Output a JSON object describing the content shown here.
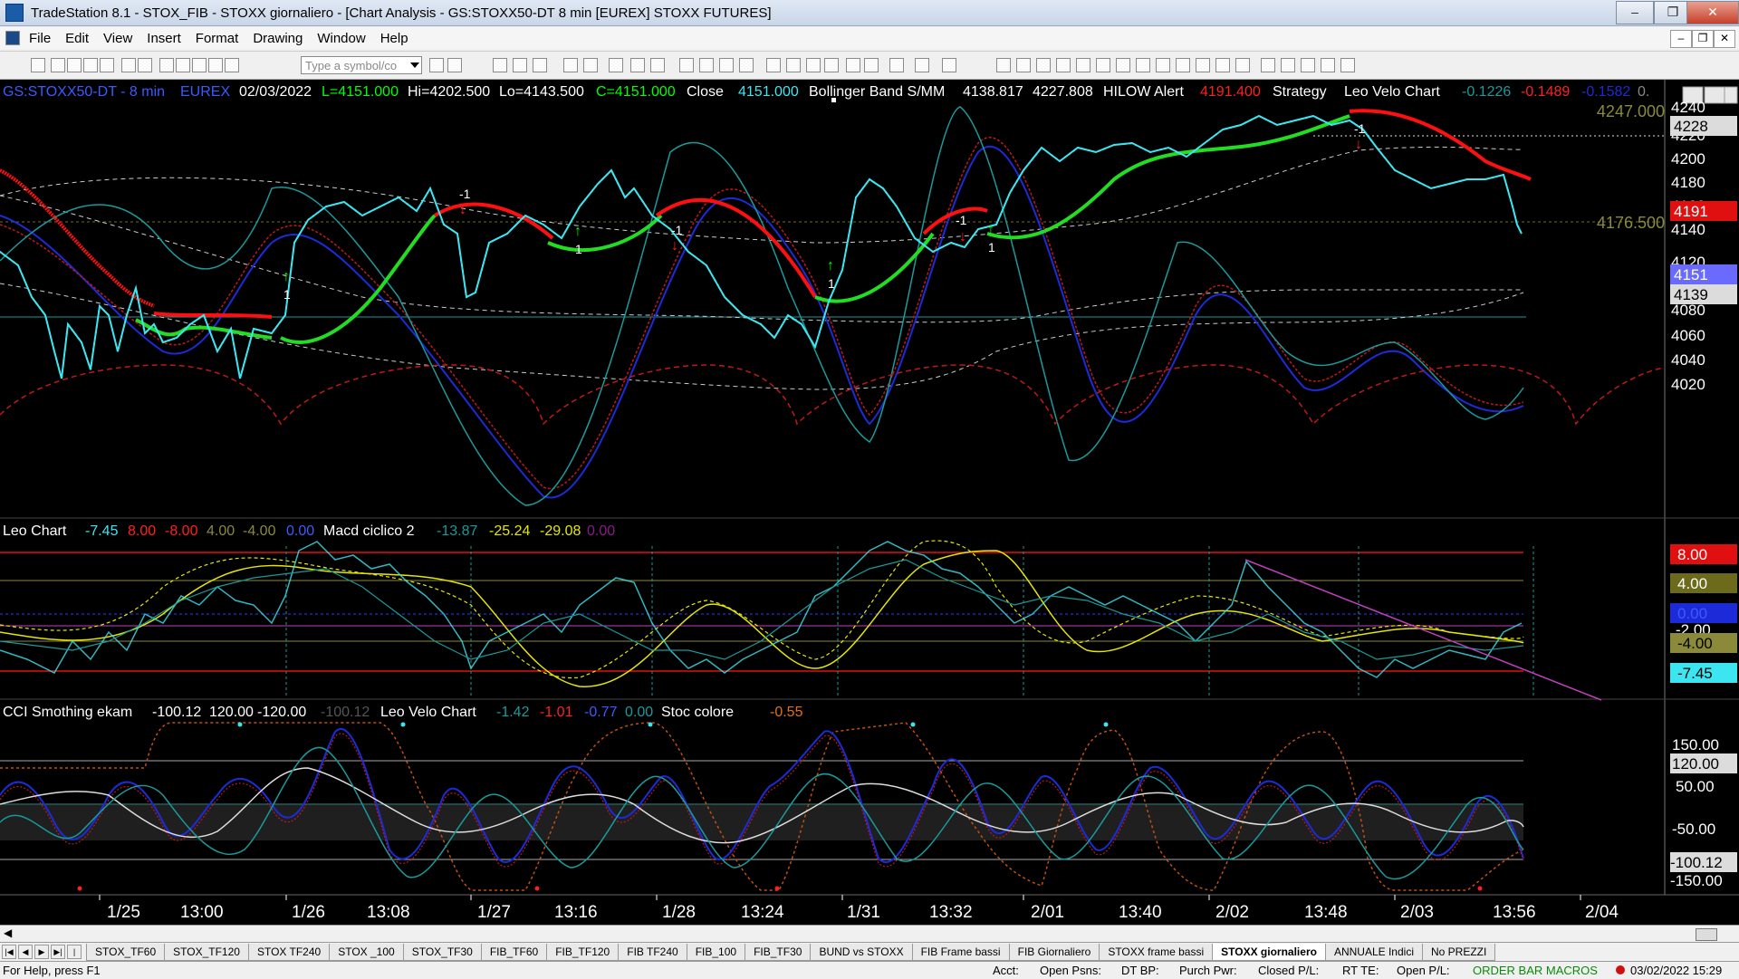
{
  "window": {
    "title": "TradeStation 8.1 - STOX_FIB - STOXX giornaliero - [Chart Analysis - GS:STOXX50-DT  8 min  [EUREX] STOXX FUTURES]"
  },
  "menu": [
    "File",
    "Edit",
    "View",
    "Insert",
    "Format",
    "Drawing",
    "Window",
    "Help"
  ],
  "toolbar": {
    "symbol_placeholder": "Type a symbol/co"
  },
  "header": {
    "symbol": "GS:STOXX50-DT - 8 min",
    "exchange": "EUREX",
    "date": "02/03/2022",
    "last": "L=4151.000",
    "high": "Hi=4202.500",
    "low": "Lo=4143.500",
    "close_eq": "C=4151.000",
    "close_label": "Close",
    "close_value": "4151.000",
    "bb_label": "Bollinger Band S/MM",
    "bb_v1": "4138.817",
    "bb_v2": "4227.808",
    "hilow_label": "HILOW Alert",
    "hilow_value": "4191.400",
    "strategy": "Strategy",
    "lvc_label": "Leo Velo Chart",
    "lvc_v1": "-0.1226",
    "lvc_v2": "-0.1489",
    "lvc_v3": "-0.1582",
    "lvc_v4": "0."
  },
  "price_axis": {
    "ticks": [
      "4240",
      "4220",
      "4200",
      "4180",
      "4160",
      "4140",
      "4120",
      "4100",
      "4080",
      "4060",
      "4040",
      "4020"
    ],
    "labels": {
      "a": "4228",
      "b": "4191",
      "c": "4151",
      "d": "4139",
      "top": "4247.000",
      "mid": "4176.500"
    }
  },
  "panel2": {
    "title": "Leo Chart",
    "v1": "-7.45",
    "v2": "8.00",
    "v3": "-8.00",
    "v4": "4.00",
    "v5": "-4.00",
    "v6": "0.00",
    "macd_label": "Macd ciclico 2",
    "m1": "-13.87",
    "m2": "-25.24",
    "m3": "-29.08",
    "m4": "0.00",
    "axis": {
      "a": "8.00",
      "b": "4.00",
      "c": "0.00",
      "d": "-2.00",
      "e": "-4.00",
      "f": "-7.45"
    }
  },
  "panel3": {
    "title": "CCI Smothing ekam",
    "v1": "-100.12",
    "v2": "120.00",
    "v3": "-120.00",
    "v4": "-100.12",
    "lvc_label": "Leo Velo Chart",
    "l1": "-1.42",
    "l2": "-1.01",
    "l3": "-0.77",
    "l4": "0.00",
    "stoc_label": "Stoc colore",
    "s1": "-0.55",
    "axis": {
      "a": "150.00",
      "b": "120.00",
      "c": "50.00",
      "d": "-50.00",
      "e": "-100.12",
      "f": "-150.00"
    }
  },
  "time_axis": [
    "1/25",
    "13:00",
    "1/26",
    "13:08",
    "1/27",
    "13:16",
    "1/28",
    "13:24",
    "1/31",
    "13:32",
    "2/01",
    "13:40",
    "2/02",
    "13:48",
    "2/03",
    "13:56",
    "2/04"
  ],
  "signals": {
    "down": "-1",
    "up": "1"
  },
  "tabs": [
    "STOX_TF60",
    "STOX_TF120",
    "STOX TF240",
    "STOX _100",
    "STOX_TF30",
    "FIB_TF60",
    "FIB_TF120",
    "FIB TF240",
    "FIB_100",
    "FIB_TF30",
    "BUND vs STOXX",
    "FIB Frame bassi",
    "FIB Giornaliero",
    "STOXX frame bassi",
    "STOXX giornaliero",
    "ANNUALE Indici",
    "No PREZZI"
  ],
  "status": {
    "help": "For Help, press F1",
    "acct": "Acct:",
    "open_psns": "Open Psns:",
    "dt_bp": "DT BP:",
    "purch": "Purch Pwr:",
    "closed_pl": "Closed P/L:",
    "rt_te": "RT TE:",
    "open_pl": "Open P/L:",
    "macros": "ORDER BAR  MACROS",
    "datetime": "03/02/2022 15:29"
  },
  "colors": {
    "price": "#3ce6f0",
    "up_signal": "#00ff00",
    "down_signal": "#ff0000",
    "blue": "#1d2ad8",
    "teal": "#1a9a9a"
  }
}
